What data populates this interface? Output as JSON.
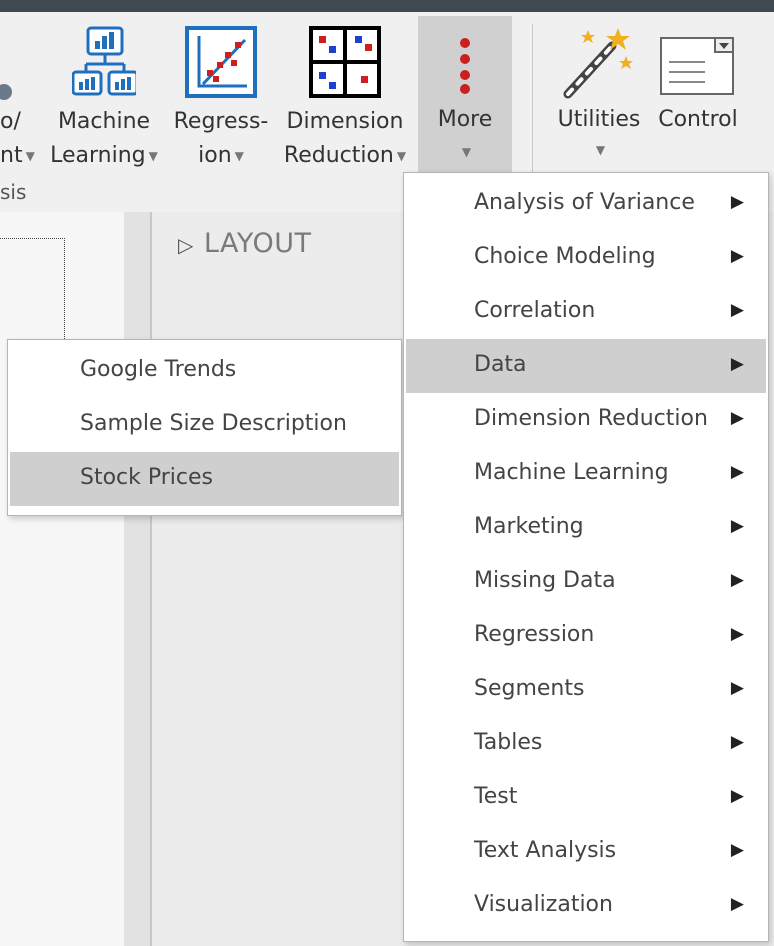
{
  "ribbon": {
    "partial_button": {
      "line1": "o/",
      "line2": "nt"
    },
    "group_label_partial": "sis",
    "buttons": [
      {
        "line1": "Machine",
        "line2": "Learning",
        "icon": "machine-learning-icon"
      },
      {
        "line1": "Regress-",
        "line2": "ion",
        "icon": "regression-icon"
      },
      {
        "line1": "Dimension",
        "line2": "Reduction",
        "icon": "dimension-reduction-icon"
      },
      {
        "line1": "More",
        "line2": "",
        "icon": "more-dots-icon"
      },
      {
        "line1": "Utilities",
        "line2": "",
        "icon": "magic-wand-icon"
      },
      {
        "line1": "Control",
        "line2": "",
        "icon": "control-combobox-icon"
      }
    ]
  },
  "layout_panel": {
    "title": "LAYOUT"
  },
  "more_menu": {
    "items": [
      {
        "label": "Analysis of Variance",
        "highlighted": false
      },
      {
        "label": "Choice Modeling",
        "highlighted": false
      },
      {
        "label": "Correlation",
        "highlighted": false
      },
      {
        "label": "Data",
        "highlighted": true
      },
      {
        "label": "Dimension Reduction",
        "highlighted": false
      },
      {
        "label": "Machine Learning",
        "highlighted": false
      },
      {
        "label": "Marketing",
        "highlighted": false
      },
      {
        "label": "Missing Data",
        "highlighted": false
      },
      {
        "label": "Regression",
        "highlighted": false
      },
      {
        "label": "Segments",
        "highlighted": false
      },
      {
        "label": "Tables",
        "highlighted": false
      },
      {
        "label": "Test",
        "highlighted": false
      },
      {
        "label": "Text Analysis",
        "highlighted": false
      },
      {
        "label": "Visualization",
        "highlighted": false
      }
    ]
  },
  "data_submenu": {
    "items": [
      {
        "label": "Google Trends",
        "highlighted": false
      },
      {
        "label": "Sample Size Description",
        "highlighted": false
      },
      {
        "label": "Stock Prices",
        "highlighted": true
      }
    ]
  },
  "colors": {
    "highlight": "#cfcfcf",
    "accent_blue": "#1f6fbf",
    "accent_red": "#cc1f1f"
  }
}
